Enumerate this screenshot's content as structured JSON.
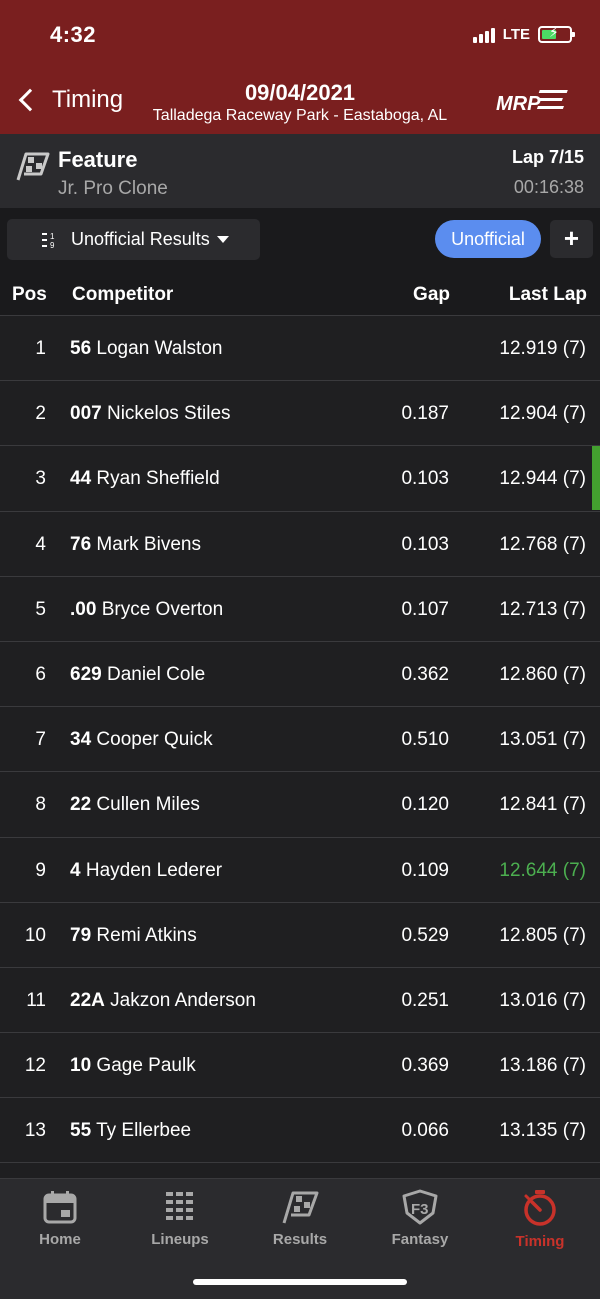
{
  "status_bar": {
    "time": "4:32",
    "network": "LTE"
  },
  "header": {
    "back_label": "Timing",
    "date": "09/04/2021",
    "venue": "Talladega Raceway Park - Eastaboga, AL",
    "logo_text": "MRP"
  },
  "event": {
    "title": "Feature",
    "class": "Jr. Pro Clone",
    "lap": "Lap 7/15",
    "elapsed": "00:16:38"
  },
  "filter": {
    "dropdown_label": "Unofficial Results",
    "status_pill": "Unofficial",
    "add_label": "+"
  },
  "columns": {
    "pos": "Pos",
    "competitor": "Competitor",
    "gap": "Gap",
    "last_lap": "Last Lap"
  },
  "results": [
    {
      "pos": "1",
      "number": "56",
      "name": "Logan Walston",
      "gap": "",
      "last_lap": "12.919 (7)"
    },
    {
      "pos": "2",
      "number": "007",
      "name": "Nickelos Stiles",
      "gap": "0.187",
      "last_lap": "12.904 (7)"
    },
    {
      "pos": "3",
      "number": "44",
      "name": "Ryan Sheffield",
      "gap": "0.103",
      "last_lap": "12.944 (7)"
    },
    {
      "pos": "4",
      "number": "76",
      "name": "Mark Bivens",
      "gap": "0.103",
      "last_lap": "12.768 (7)"
    },
    {
      "pos": "5",
      "number": ".00",
      "name": "Bryce Overton",
      "gap": "0.107",
      "last_lap": "12.713 (7)"
    },
    {
      "pos": "6",
      "number": "629",
      "name": "Daniel Cole",
      "gap": "0.362",
      "last_lap": "12.860 (7)"
    },
    {
      "pos": "7",
      "number": "34",
      "name": "Cooper Quick",
      "gap": "0.510",
      "last_lap": "13.051 (7)"
    },
    {
      "pos": "8",
      "number": "22",
      "name": "Cullen Miles",
      "gap": "0.120",
      "last_lap": "12.841 (7)"
    },
    {
      "pos": "9",
      "number": "4",
      "name": "Hayden Lederer",
      "gap": "0.109",
      "last_lap": "12.644 (7)"
    },
    {
      "pos": "10",
      "number": "79",
      "name": "Remi Atkins",
      "gap": "0.529",
      "last_lap": "12.805 (7)"
    },
    {
      "pos": "11",
      "number": "22A",
      "name": "Jakzon Anderson",
      "gap": "0.251",
      "last_lap": "13.016 (7)"
    },
    {
      "pos": "12",
      "number": "10",
      "name": "Gage Paulk",
      "gap": "0.369",
      "last_lap": "13.186 (7)"
    },
    {
      "pos": "13",
      "number": "55",
      "name": "Ty Ellerbee",
      "gap": "0.066",
      "last_lap": "13.135 (7)"
    }
  ],
  "tabs": [
    {
      "label": "Home",
      "icon": "calendar-icon",
      "active": false
    },
    {
      "label": "Lineups",
      "icon": "lineups-icon",
      "active": false
    },
    {
      "label": "Results",
      "icon": "checkered-flag-icon",
      "active": false
    },
    {
      "label": "Fantasy",
      "icon": "fantasy-shield-icon",
      "active": false
    },
    {
      "label": "Timing",
      "icon": "stopwatch-icon",
      "active": true
    }
  ],
  "colors": {
    "header": "#7a1f1f",
    "accent_blue": "#5b8def",
    "best_lap_green": "#4caf50",
    "active_tab": "#c8322a"
  }
}
